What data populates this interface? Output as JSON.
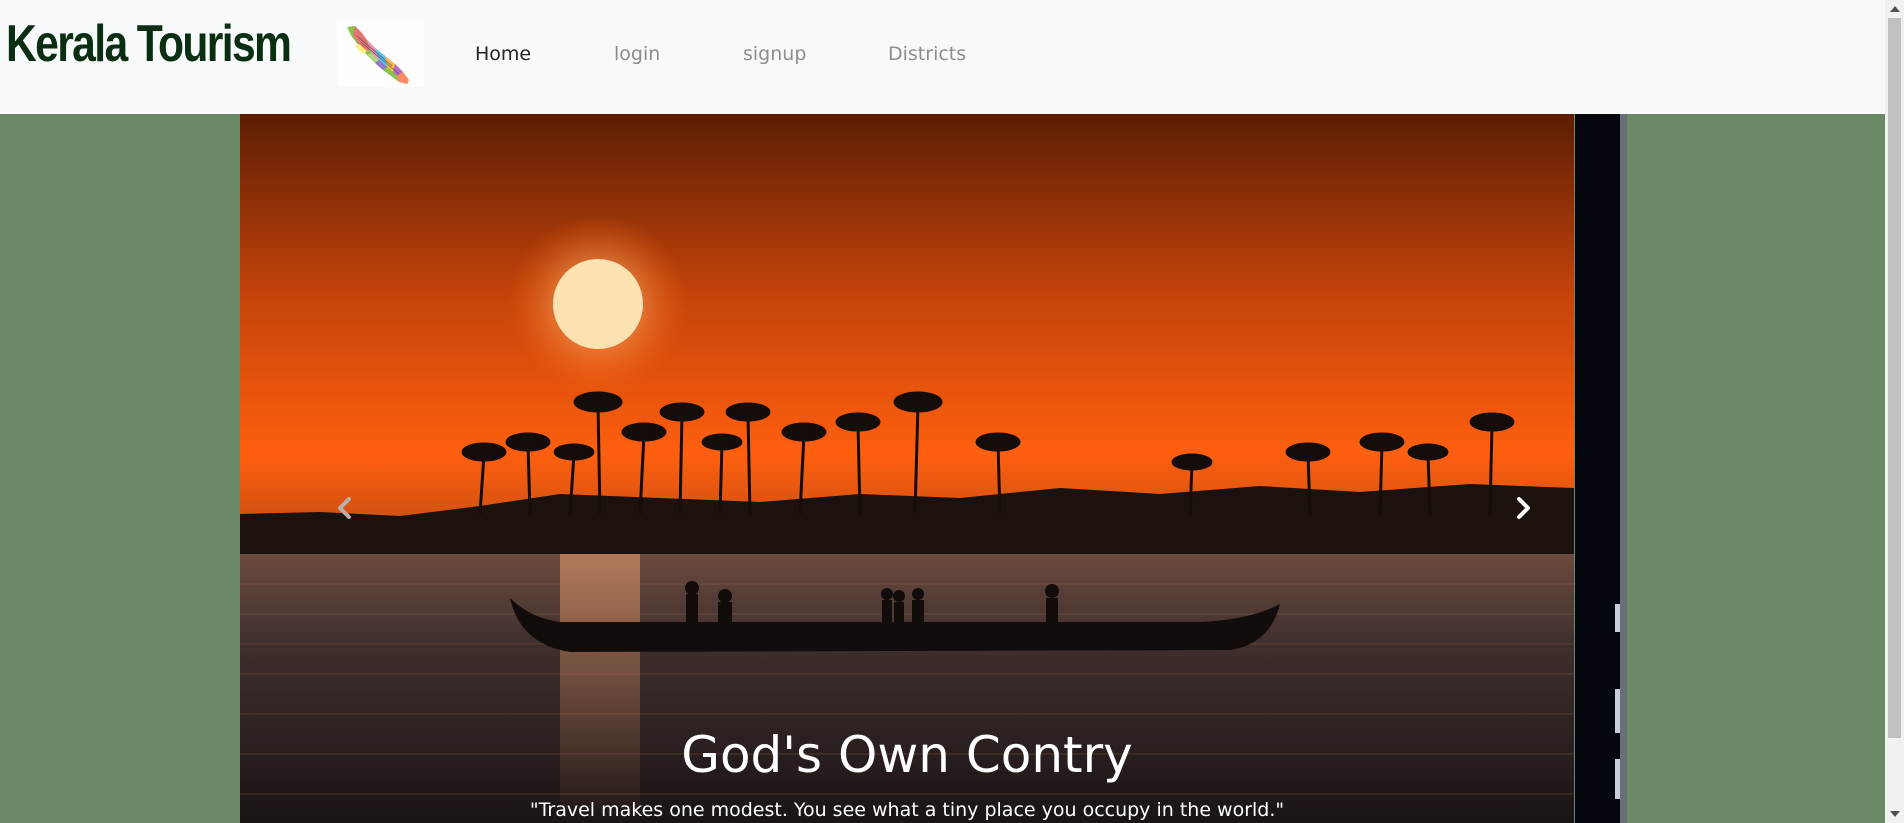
{
  "navbar": {
    "brand": "Kerala Tourism",
    "logo_icon": "kerala-map-icon",
    "links": [
      {
        "label": "Home",
        "active": true
      },
      {
        "label": "login",
        "active": false
      },
      {
        "label": "signup",
        "active": false
      },
      {
        "label": "Districts",
        "active": false
      }
    ]
  },
  "carousel": {
    "caption_title": "God's Own Contry",
    "caption_quote": "\"Travel makes one modest. You see what a tiny place you occupy in the world.\"",
    "prev_icon": "chevron-left-icon",
    "next_icon": "chevron-right-icon"
  },
  "colors": {
    "page_background": "#6a8a66",
    "navbar_background": "#f8f9fa",
    "brand_text": "#0a2e12",
    "sky_top": "#5a1e05",
    "sky_mid": "#c94a0a",
    "sun": "#fbe2b0"
  }
}
